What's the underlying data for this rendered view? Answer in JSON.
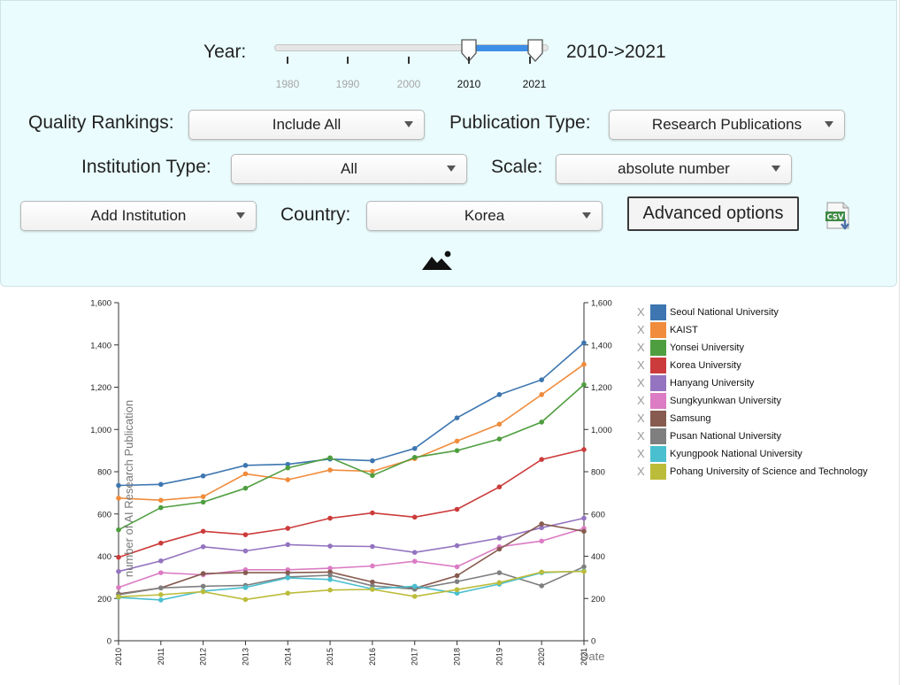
{
  "filters": {
    "year_label": "Year:",
    "year_range_text": "2010->2021",
    "slider_ticks": [
      {
        "label": "1980",
        "active": false
      },
      {
        "label": "1990",
        "active": false
      },
      {
        "label": "2000",
        "active": false
      },
      {
        "label": "2010",
        "active": true
      },
      {
        "label": "2021",
        "active": true
      }
    ],
    "quality_label": "Quality Rankings:",
    "quality_value": "Include All",
    "pubtype_label": "Publication Type:",
    "pubtype_value": "Research Publications",
    "insttype_label": "Institution Type:",
    "insttype_value": "All",
    "scale_label": "Scale:",
    "scale_value": "absolute number",
    "add_institution": "Add Institution",
    "country_label": "Country:",
    "country_value": "Korea",
    "advanced_button": "Advanced options",
    "csv_icon": "csv-download-icon",
    "image_icon": "image-export-icon",
    "slider_range_color": "#3d8ee8",
    "panel_color": "#eafcfd"
  },
  "legend_remove": "X",
  "chart_data": {
    "type": "line",
    "x": [
      2010,
      2011,
      2012,
      2013,
      2014,
      2015,
      2016,
      2017,
      2018,
      2019,
      2020,
      2021
    ],
    "xlabel": "Date",
    "ylabel": "number of AI Research Publication",
    "ylim": [
      0,
      1600
    ],
    "yticks": [
      "0",
      "200",
      "400",
      "600",
      "800",
      "1,000",
      "1,200",
      "1,400",
      "1,600"
    ],
    "legend_position": "right",
    "series": [
      {
        "name": "Seoul National University",
        "color": "#3d76b0",
        "values": [
          735,
          740,
          780,
          830,
          835,
          860,
          852,
          910,
          1055,
          1165,
          1235,
          1410
        ]
      },
      {
        "name": "KAIST",
        "color": "#f08c3c",
        "values": [
          675,
          665,
          682,
          790,
          762,
          808,
          802,
          862,
          945,
          1025,
          1165,
          1308
        ]
      },
      {
        "name": "Yonsei University",
        "color": "#4e9e3f",
        "values": [
          525,
          630,
          656,
          722,
          818,
          866,
          782,
          868,
          900,
          955,
          1035,
          1212
        ]
      },
      {
        "name": "Korea University",
        "color": "#cc3b3b",
        "values": [
          395,
          462,
          518,
          502,
          532,
          580,
          605,
          585,
          622,
          728,
          858,
          905
        ]
      },
      {
        "name": "Hanyang University",
        "color": "#9474c0",
        "values": [
          328,
          378,
          445,
          425,
          455,
          448,
          446,
          418,
          450,
          486,
          535,
          580
        ]
      },
      {
        "name": "Sungkyunkwan University",
        "color": "#db7cc4",
        "values": [
          252,
          322,
          312,
          336,
          336,
          343,
          354,
          376,
          350,
          445,
          472,
          532
        ]
      },
      {
        "name": "Samsung",
        "color": "#875b50",
        "values": [
          222,
          250,
          318,
          322,
          322,
          325,
          278,
          248,
          308,
          434,
          553,
          518
        ]
      },
      {
        "name": "Pusan National University",
        "color": "#7f7f7f",
        "values": [
          218,
          250,
          258,
          262,
          302,
          310,
          260,
          244,
          280,
          322,
          260,
          350
        ]
      },
      {
        "name": "Kyungpook National University",
        "color": "#49bfcf",
        "values": [
          205,
          193,
          235,
          252,
          298,
          290,
          245,
          258,
          225,
          268,
          322,
          330
        ]
      },
      {
        "name": "Pohang University of Science and Technology",
        "color": "#bcbc3b",
        "values": [
          208,
          218,
          232,
          195,
          225,
          240,
          243,
          210,
          242,
          275,
          325,
          328
        ]
      }
    ]
  }
}
